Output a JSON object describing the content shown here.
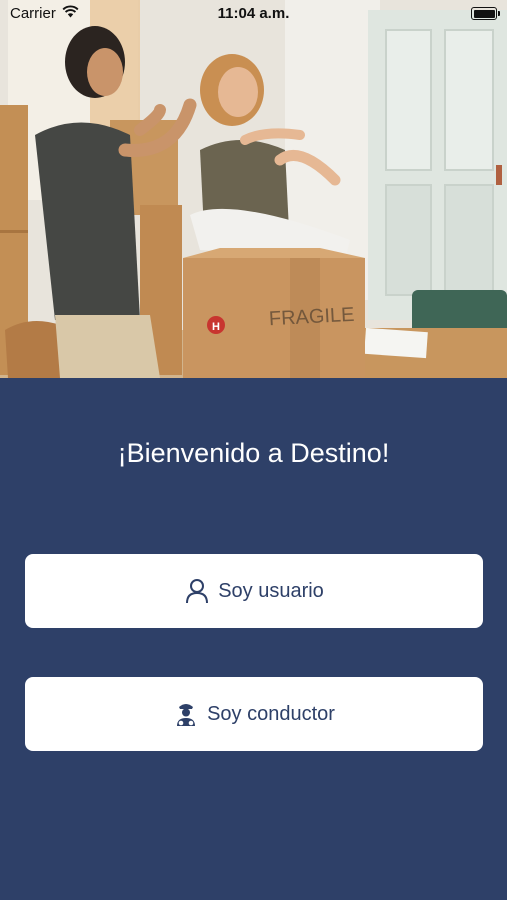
{
  "status_bar": {
    "carrier": "Carrier",
    "time": "11:04 a.m.",
    "wifi_icon": "wifi-icon",
    "battery_icon": "battery-icon"
  },
  "hero": {
    "box_label": "FRAGILE",
    "box_logo": "H"
  },
  "welcome_title": "¡Bienvenido a Destino!",
  "buttons": {
    "user": {
      "label": "Soy usuario",
      "icon": "person-icon"
    },
    "driver": {
      "label": "Soy conductor",
      "icon": "driver-icon"
    }
  },
  "colors": {
    "background": "#2e4068",
    "button_bg": "#ffffff",
    "button_text": "#2e4068",
    "title_text": "#ffffff"
  }
}
